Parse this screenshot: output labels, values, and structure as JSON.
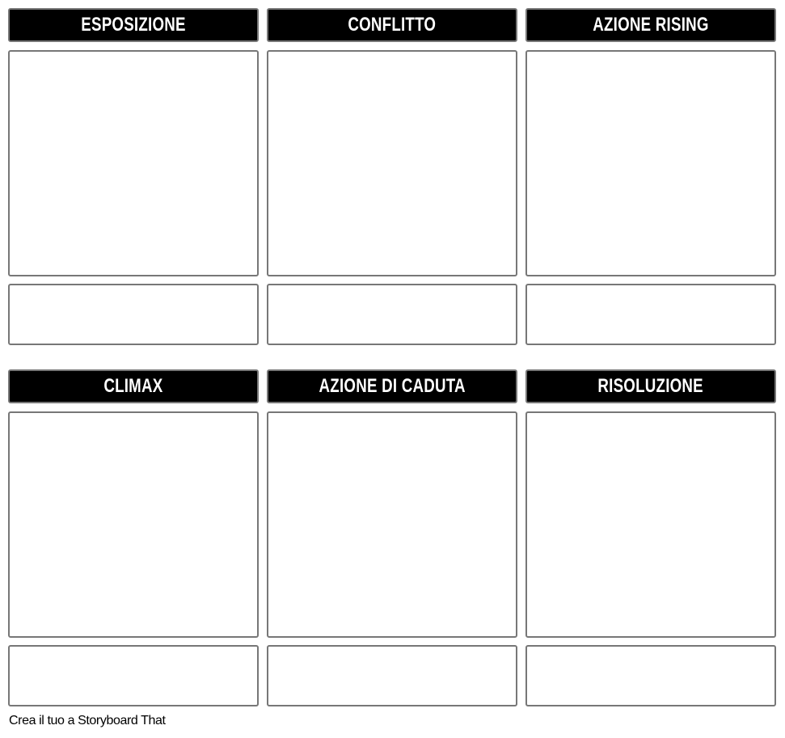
{
  "cells": [
    {
      "title": "ESPOSIZIONE"
    },
    {
      "title": "CONFLITTO"
    },
    {
      "title": "AZIONE RISING"
    },
    {
      "title": "CLIMAX"
    },
    {
      "title": "AZIONE DI CADUTA"
    },
    {
      "title": "RISOLUZIONE"
    }
  ],
  "footer": "Crea il tuo a Storyboard That"
}
